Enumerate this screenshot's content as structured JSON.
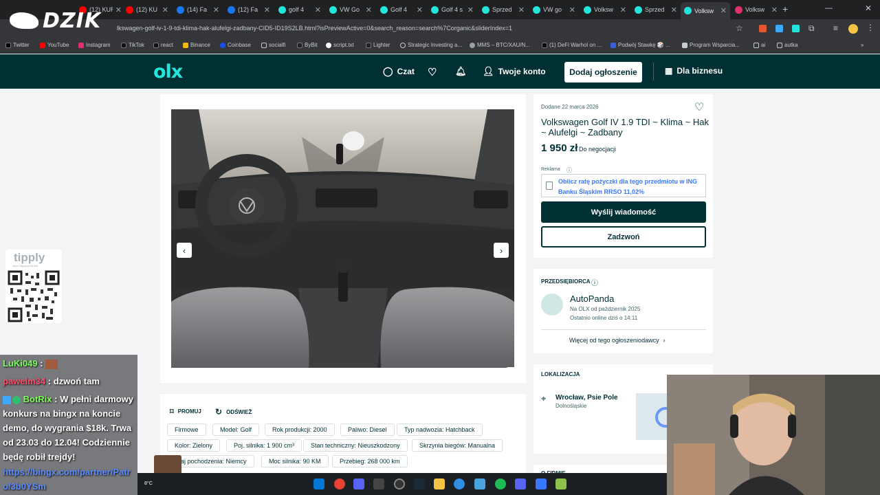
{
  "browser": {
    "tabs": [
      {
        "label": "(12) KUR",
        "color": "#ff0000"
      },
      {
        "label": "(12) KU",
        "color": "#ff0000"
      },
      {
        "label": "(14) Fa",
        "color": "#1877f2"
      },
      {
        "label": "(12) Fa",
        "color": "#1877f2"
      },
      {
        "label": "golf 4",
        "color": "#23e5db"
      },
      {
        "label": "VW Go",
        "color": "#23e5db"
      },
      {
        "label": "Golf 4",
        "color": "#23e5db"
      },
      {
        "label": "Golf 4 s",
        "color": "#23e5db"
      },
      {
        "label": "Sprzed",
        "color": "#23e5db"
      },
      {
        "label": "VW go",
        "color": "#23e5db"
      },
      {
        "label": "Volksw",
        "color": "#23e5db"
      },
      {
        "label": "Sprzed",
        "color": "#23e5db"
      },
      {
        "label": "Volksw",
        "color": "#23e5db"
      },
      {
        "label": "Volksw",
        "color": "#e1306c"
      }
    ],
    "url": "lkswagen-golf-iv-1-9-tdi-klima-hak-alufelgi-zadbany-CID5-ID19S2LB.html?isPreviewActive=0&search_reason=search%7Corganic&sliderIndex=1",
    "bookmarks": [
      "Twitter",
      "YouTube",
      "Instagram",
      "TikTok",
      "react",
      "Binance",
      "Coinbase",
      "socialfi",
      "ByBit",
      "script.txt",
      "Lighter",
      "Strategic Investing a...",
      "MMS – BTC/XAU/N...",
      "(1) DeFi Warhol on ...",
      "Podwój Stawkę 🎲 ...",
      "Program Wsparcia...",
      "ai",
      "autka"
    ]
  },
  "overlay": {
    "logo_text": "DZIK",
    "tipply_label": "tipply",
    "tipply_url": "https://tipply.pl/@dzik",
    "chat": [
      {
        "user": "LuKi049",
        "sep": " : ",
        "text": "",
        "color": "#7fff5f"
      },
      {
        "user": "pawelm34",
        "sep": " : ",
        "text": "dzwoń tam",
        "color": "#ff4d6d"
      },
      {
        "user": "BotRix",
        "sep": " : ",
        "text": "W pełni darmowy konkurs na bingx na koncie demo, do wygrania $18k. Trwa od 23.03 do 12.04! Codziennie będę robił trejdy!",
        "color": "#7fff5f"
      },
      {
        "user": "",
        "sep": "",
        "text": "https://bingx.com/partner/Patro/3b0YSm",
        "color": "#5b8cff"
      }
    ],
    "emote_count": "x5"
  },
  "olx": {
    "logo": "olx",
    "nav": {
      "chat": "Czat",
      "account": "Twoje konto",
      "post_button": "Dodaj ogłoszenie",
      "business": "Dla biznesu"
    },
    "listing": {
      "date": "Dodane 22 marca 2026",
      "title": "Volkswagen Golf IV 1.9 TDI ~ Klima ~ Hak ~ Alufelgi ~ Zadbany",
      "price": "1 950 zł",
      "negotiable": "Do negocjacji",
      "ad_label": "Reklama",
      "ad_text": "Oblicz ratę pożyczki dla tego przedmiotu w ING Banku Śląskim RRSO 11,02%",
      "message_button": "Wyślij wiadomość",
      "call_button": "Zadzwoń"
    },
    "seller": {
      "section": "PRZEDSIĘBIORCA",
      "name": "AutoPanda",
      "since": "Na OLX od październik 2025",
      "online": "Ostatnio online dziś o 14:11",
      "more_link": "Więcej od tego ogłoszeniodawcy"
    },
    "location": {
      "section": "LOKALIZACJA",
      "city": "Wrocław, Psie Pole",
      "region": "Dolnośląskie"
    },
    "firm": {
      "section": "O FIRMIE"
    },
    "actions": {
      "promote": "PROMUJ",
      "refresh": "ODŚWIEŻ"
    },
    "params": [
      "Firmowe",
      "Model: Golf",
      "Rok produkcji: 2000",
      "Paliwo: Diesel",
      "Typ nadwozia: Hatchback",
      "Kolor: Zielony",
      "Poj. silnika: 1 900 cm³",
      "Stan techniczny: Nieuszkodzony",
      "Skrzynia biegów: Manualna",
      "Kraj pochodzenia: Niemcy",
      "Moc silnika: 90 KM",
      "Przebieg: 268 000 km"
    ]
  },
  "taskbar": {
    "weather": "8°C"
  }
}
